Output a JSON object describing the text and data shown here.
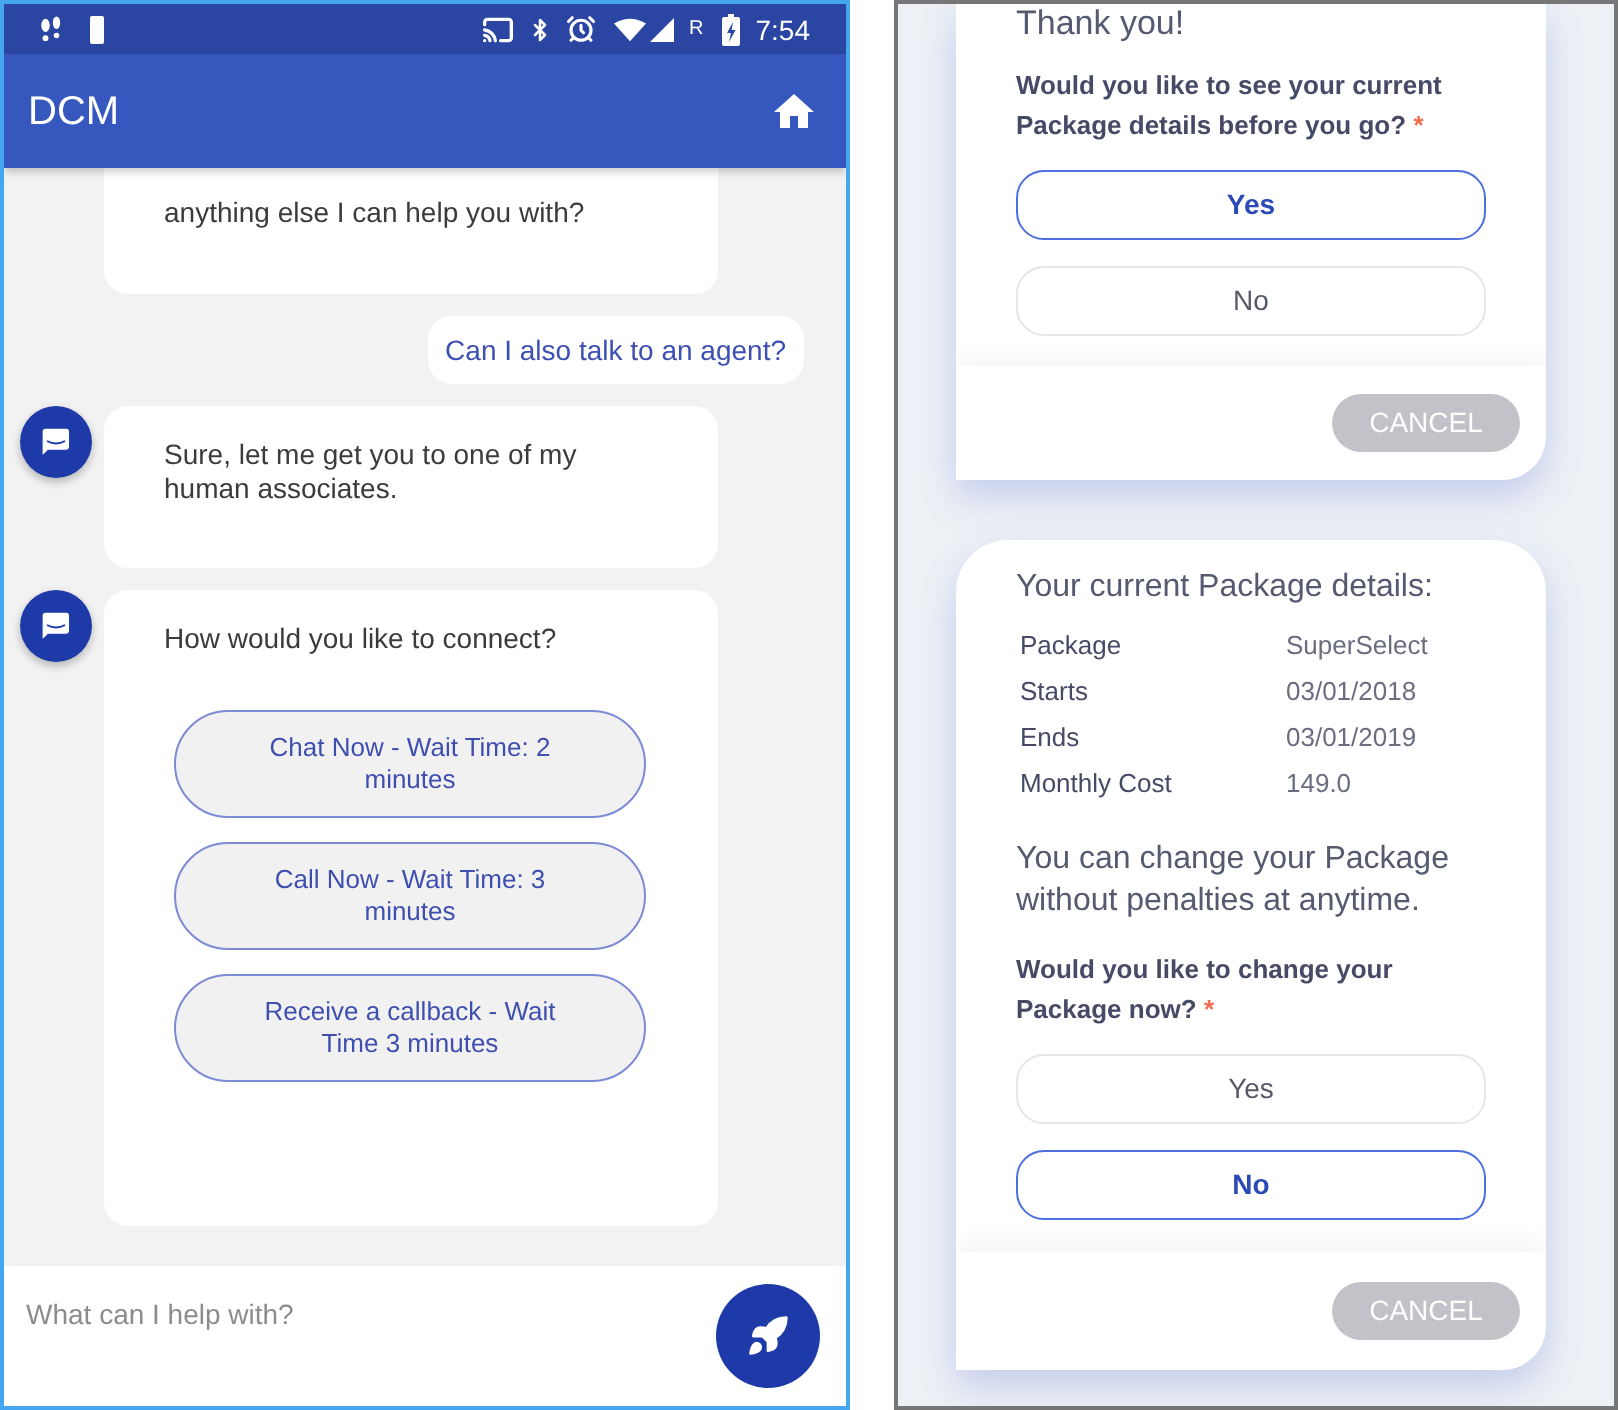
{
  "phone": {
    "status_bar": {
      "network_label": "R",
      "time": "7:54"
    },
    "app_bar": {
      "title": "DCM"
    },
    "messages": [
      {
        "kind": "bot",
        "avatar": false,
        "text": "anything else I can help you with?"
      },
      {
        "kind": "user",
        "text": "Can I also talk to an agent?"
      },
      {
        "kind": "bot",
        "avatar": true,
        "text": "Sure, let me get you to one of my human associates."
      },
      {
        "kind": "bot",
        "avatar": true,
        "text": "How would you like to connect?",
        "options": [
          "Chat Now - Wait Time: 2 minutes",
          "Call Now - Wait Time: 3 minutes",
          "Receive a callback - Wait Time 3 minutes"
        ]
      }
    ],
    "composer": {
      "placeholder": "What can I help with?"
    }
  },
  "form_cards": [
    {
      "heading": "Thank you!",
      "question": "Would you like to see your current Package details before you go?",
      "required_mark": "*",
      "choices": [
        {
          "label": "Yes",
          "selected": true
        },
        {
          "label": "No",
          "selected": false
        }
      ],
      "cancel_label": "CANCEL"
    },
    {
      "heading": "Your current Package details:",
      "details": [
        {
          "label": "Package",
          "value": "SuperSelect"
        },
        {
          "label": "Starts",
          "value": "03/01/2018"
        },
        {
          "label": "Ends",
          "value": "03/01/2019"
        },
        {
          "label": "Monthly Cost",
          "value": "149.0"
        }
      ],
      "note": "You can change your Package without penalties at anytime.",
      "question": "Would you like to change your Package now?",
      "required_mark": "*",
      "choices": [
        {
          "label": "Yes",
          "selected": false
        },
        {
          "label": "No",
          "selected": true
        }
      ],
      "cancel_label": "CANCEL"
    }
  ]
}
